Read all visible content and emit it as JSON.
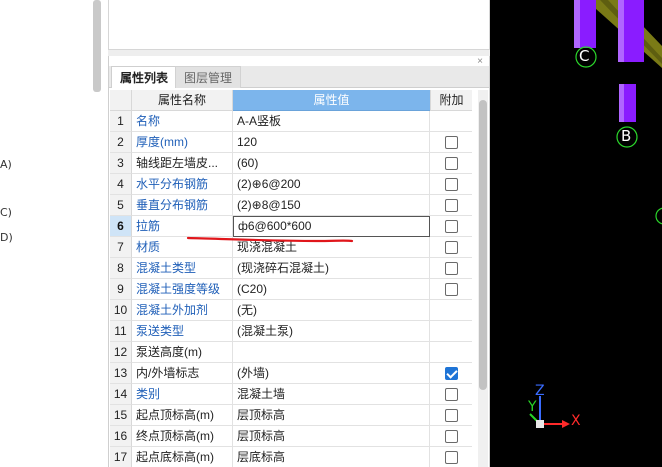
{
  "left_fragments": [
    "A)",
    "C)",
    "D)"
  ],
  "panel": {
    "close_glyph": "×",
    "tabs": [
      {
        "label": "属性列表",
        "active": true
      },
      {
        "label": "图层管理",
        "active": false
      }
    ],
    "headers": {
      "name": "属性名称",
      "value": "属性值",
      "extra": "附加"
    },
    "rows": [
      {
        "num": "1",
        "name": "名称",
        "value": "A-A竖板",
        "checkbox": false,
        "blue": true
      },
      {
        "num": "2",
        "name": "厚度(mm)",
        "value": "120",
        "checkbox": true,
        "checked": false,
        "blue": true
      },
      {
        "num": "3",
        "name": "轴线距左墙皮...",
        "value": "(60)",
        "checkbox": true,
        "checked": false,
        "blue": false
      },
      {
        "num": "4",
        "name": "水平分布钢筋",
        "value": "(2)⊕6@200",
        "checkbox": true,
        "checked": false,
        "blue": true
      },
      {
        "num": "5",
        "name": "垂直分布钢筋",
        "value": "(2)⊕8@150",
        "checkbox": true,
        "checked": false,
        "blue": true
      },
      {
        "num": "6",
        "name": "拉筋",
        "value": "ф6@600*600",
        "checkbox": true,
        "checked": false,
        "blue": true,
        "selected": true
      },
      {
        "num": "7",
        "name": "材质",
        "value": "现浇混凝土",
        "checkbox": true,
        "checked": false,
        "blue": true
      },
      {
        "num": "8",
        "name": "混凝土类型",
        "value": "(现浇碎石混凝土)",
        "checkbox": true,
        "checked": false,
        "blue": true
      },
      {
        "num": "9",
        "name": "混凝土强度等级",
        "value": "(C20)",
        "checkbox": true,
        "checked": false,
        "blue": true
      },
      {
        "num": "10",
        "name": "混凝土外加剂",
        "value": "(无)",
        "checkbox": false,
        "blue": true
      },
      {
        "num": "11",
        "name": "泵送类型",
        "value": "(混凝土泵)",
        "checkbox": false,
        "blue": true
      },
      {
        "num": "12",
        "name": "泵送高度(m)",
        "value": "",
        "checkbox": false,
        "blue": false
      },
      {
        "num": "13",
        "name": "内/外墙标志",
        "value": "(外墙)",
        "checkbox": true,
        "checked": true,
        "blue": false
      },
      {
        "num": "14",
        "name": "类别",
        "value": "混凝土墙",
        "checkbox": true,
        "checked": false,
        "blue": true
      },
      {
        "num": "15",
        "name": "起点顶标高(m)",
        "value": "层顶标高",
        "checkbox": true,
        "checked": false,
        "blue": false
      },
      {
        "num": "16",
        "name": "终点顶标高(m)",
        "value": "层顶标高",
        "checkbox": true,
        "checked": false,
        "blue": false
      },
      {
        "num": "17",
        "name": "起点底标高(m)",
        "value": "层底标高",
        "checkbox": true,
        "checked": false,
        "blue": false
      }
    ]
  },
  "viewport": {
    "node_labels": [
      "C",
      "B"
    ],
    "axes": {
      "z": "Z",
      "y": "Y",
      "x": "X"
    },
    "colors": {
      "column": "#8a1cff",
      "column_light": "#b066ff",
      "slab": "#7a7a16",
      "node": "#2bd62b",
      "axis_x": "#ff2a2a",
      "axis_y": "#27d427",
      "axis_z": "#3a6cff",
      "annotation_mark": "#e0161b"
    }
  }
}
